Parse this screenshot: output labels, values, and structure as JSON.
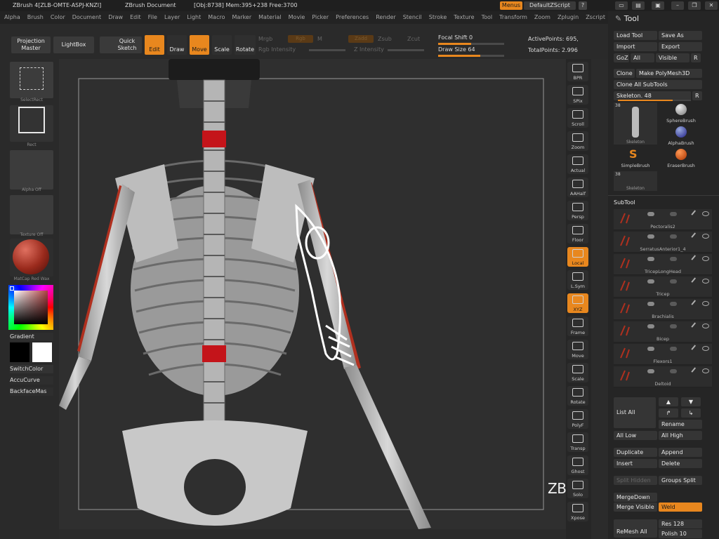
{
  "titlebar": {
    "app": "ZBrush 4[ZLB-OMTE-ASPJ-KNZI]",
    "document": "ZBrush Document",
    "stats": "[Obj:8738] Mem:395+238 Free:3700",
    "menus_btn": "Menus",
    "script": "DefaultZScript"
  },
  "menubar": [
    "Alpha",
    "Brush",
    "Color",
    "Document",
    "Draw",
    "Edit",
    "File",
    "Layer",
    "Light",
    "Macro",
    "Marker",
    "Material",
    "Movie",
    "Picker",
    "Preferences",
    "Render",
    "Stencil",
    "Stroke",
    "Texture",
    "Tool",
    "Transform",
    "Zoom",
    "Zplugin",
    "Zscript"
  ],
  "toolbar": {
    "projection_master": "Projection Master",
    "lightbox": "LightBox",
    "quick_sketch": "Quick Sketch",
    "edit": "Edit",
    "draw": "Draw",
    "move": "Move",
    "scale": "Scale",
    "rotate": "Rotate",
    "mrgb": "Mrgb",
    "rgb": "Rgb",
    "m": "M",
    "zadd": "Zadd",
    "zsub": "Zsub",
    "zcut": "Zcut",
    "rgb_intensity": "Rgb Intensity",
    "z_intensity": "Z Intensity",
    "focal_shift": "Focal Shift 0",
    "draw_size": "Draw Size 64",
    "focal_shift_value": 0,
    "draw_size_value": 64,
    "active_points": "ActivePoints: 695,",
    "total_points": "TotalPoints: 2.996"
  },
  "left": {
    "selectrect": "SelectRect",
    "rect": "Rect",
    "alpha_off": "Alpha Off",
    "texture_off": "Texture Off",
    "matcap": "MatCap Red Wax",
    "gradient": "Gradient",
    "switchcolor": "SwitchColor",
    "accucurve": "AccuCurve",
    "backfacemask": "BackfaceMas",
    "main_color": "#7d1a12",
    "secondary_color": "#ffffff"
  },
  "right_shelf": [
    "BPR",
    "SPix",
    "Scroll",
    "Zoom",
    "Actual",
    "AAHalf",
    "Persp",
    "Floor",
    "Local",
    "L.Sym",
    "XYZ",
    "Frame",
    "Move",
    "Scale",
    "Rotate",
    "PolyF",
    "Transp",
    "Ghost",
    "Solo",
    "Xpose"
  ],
  "panel": {
    "title": "Tool",
    "load_tool": "Load Tool",
    "save_as": "Save As",
    "import": "Import",
    "export": "Export",
    "goz": "GoZ",
    "all": "All",
    "visible": "Visible",
    "r": "R",
    "clone": "Clone",
    "make_polymesh": "Make PolyMesh3D",
    "clone_all": "Clone All SubTools",
    "skeleton": "Skeleton. 48",
    "skeleton_value": 48,
    "tools": [
      {
        "name": "Skeleton",
        "count": "38"
      },
      {
        "name": "SphereBrush"
      },
      {
        "name": "AlphaBrush"
      },
      {
        "name": "SimpleBrush"
      },
      {
        "name": "EraserBrush"
      },
      {
        "name": "Skeleton",
        "count": "38"
      }
    ],
    "subtool_title": "SubTool",
    "subtools": [
      "Pectoralis2",
      "SerratusAnterior1_4",
      "TricepLongHead",
      "Tricep",
      "Brachialis",
      "Bicep",
      "Flexors1",
      "Deltoid"
    ],
    "list_all": "List All",
    "rename": "Rename",
    "all_low": "All Low",
    "all_high": "All High",
    "duplicate": "Duplicate",
    "append": "Append",
    "insert": "Insert",
    "delete": "Delete",
    "split_hidden": "Split Hidden",
    "groups_split": "Groups Split",
    "merge_down": "MergeDown",
    "merge_visible": "Merge Visible",
    "weld": "Weld",
    "remesh_all": "ReMesh All",
    "res": "Res 128",
    "polish": "Polish 10"
  },
  "watermark": "ZBrushWorkshops",
  "colors": {
    "accent": "#e8871e",
    "bone": "#c9c9c9",
    "muscle": "#b0301f",
    "red_marker": "#c4141a"
  }
}
